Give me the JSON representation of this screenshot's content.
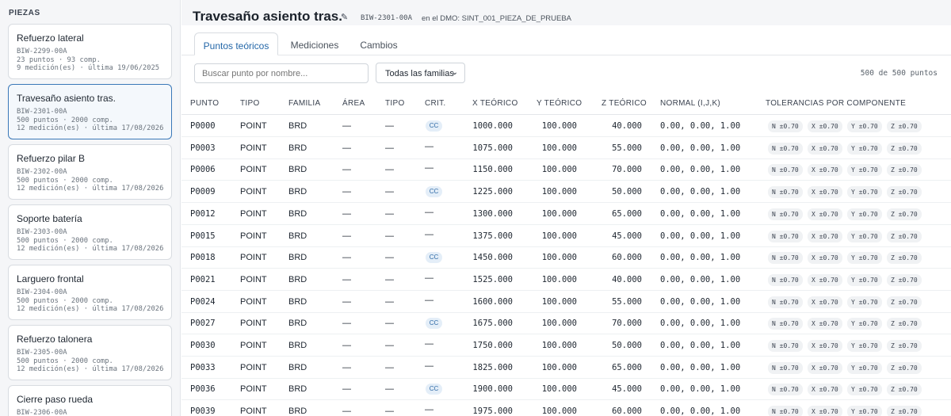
{
  "sidebar": {
    "title": "PIEZAS",
    "cards": [
      {
        "name": "Refuerzo lateral",
        "code": "BIW-2299-00A",
        "points": "23 puntos · 93 comp.",
        "measure": "9 medición(es) · última 19/06/2025"
      },
      {
        "name": "Travesaño asiento tras.",
        "code": "BIW-2301-00A",
        "points": "500 puntos · 2000 comp.",
        "measure": "12 medición(es) · última 17/08/2026"
      },
      {
        "name": "Refuerzo pilar B",
        "code": "BIW-2302-00A",
        "points": "500 puntos · 2000 comp.",
        "measure": "12 medición(es) · última 17/08/2026"
      },
      {
        "name": "Soporte batería",
        "code": "BIW-2303-00A",
        "points": "500 puntos · 2000 comp.",
        "measure": "12 medición(es) · última 17/08/2026"
      },
      {
        "name": "Larguero frontal",
        "code": "BIW-2304-00A",
        "points": "500 puntos · 2000 comp.",
        "measure": "12 medición(es) · última 17/08/2026"
      },
      {
        "name": "Refuerzo talonera",
        "code": "BIW-2305-00A",
        "points": "500 puntos · 2000 comp.",
        "measure": "12 medición(es) · última 17/08/2026"
      },
      {
        "name": "Cierre paso rueda",
        "code": "BIW-2306-00A",
        "points": "",
        "measure": ""
      }
    ]
  },
  "header": {
    "title": "Travesaño asiento tras.",
    "edit_icon": "pencil-icon",
    "code": "BIW-2301-00A",
    "dmo": "en el DMO: SINT_001_PIEZA_DE_PRUEBA"
  },
  "tabs": [
    "Puntos teóricos",
    "Mediciones",
    "Cambios"
  ],
  "filters": {
    "search_placeholder": "Buscar punto por nombre...",
    "family_select": "Todas las familias",
    "count": "500 de 500 puntos"
  },
  "table": {
    "columns": [
      "PUNTO",
      "TIPO",
      "FAMILIA",
      "ÁREA",
      "TIPO",
      "CRIT.",
      "X TEÓRICO",
      "Y TEÓRICO",
      "Z TEÓRICO",
      "NORMAL (I,J,K)",
      "TOLERANCIAS POR COMPONENTE"
    ],
    "rows": [
      {
        "punto": "P0000",
        "tipo": "POINT",
        "familia": "BRD",
        "area": "—",
        "tipo2": "—",
        "crit": "CC",
        "x": "1000.000",
        "y": "100.000",
        "z": "40.000",
        "normal": "0.00, 0.00, 1.00",
        "tol": [
          "N ±0.70",
          "X ±0.70",
          "Y ±0.70",
          "Z ±0.70"
        ]
      },
      {
        "punto": "P0003",
        "tipo": "POINT",
        "familia": "BRD",
        "area": "—",
        "tipo2": "—",
        "crit": "—",
        "x": "1075.000",
        "y": "100.000",
        "z": "55.000",
        "normal": "0.00, 0.00, 1.00",
        "tol": [
          "N ±0.70",
          "X ±0.70",
          "Y ±0.70",
          "Z ±0.70"
        ]
      },
      {
        "punto": "P0006",
        "tipo": "POINT",
        "familia": "BRD",
        "area": "—",
        "tipo2": "—",
        "crit": "—",
        "x": "1150.000",
        "y": "100.000",
        "z": "70.000",
        "normal": "0.00, 0.00, 1.00",
        "tol": [
          "N ±0.70",
          "X ±0.70",
          "Y ±0.70",
          "Z ±0.70"
        ]
      },
      {
        "punto": "P0009",
        "tipo": "POINT",
        "familia": "BRD",
        "area": "—",
        "tipo2": "—",
        "crit": "CC",
        "x": "1225.000",
        "y": "100.000",
        "z": "50.000",
        "normal": "0.00, 0.00, 1.00",
        "tol": [
          "N ±0.70",
          "X ±0.70",
          "Y ±0.70",
          "Z ±0.70"
        ]
      },
      {
        "punto": "P0012",
        "tipo": "POINT",
        "familia": "BRD",
        "area": "—",
        "tipo2": "—",
        "crit": "—",
        "x": "1300.000",
        "y": "100.000",
        "z": "65.000",
        "normal": "0.00, 0.00, 1.00",
        "tol": [
          "N ±0.70",
          "X ±0.70",
          "Y ±0.70",
          "Z ±0.70"
        ]
      },
      {
        "punto": "P0015",
        "tipo": "POINT",
        "familia": "BRD",
        "area": "—",
        "tipo2": "—",
        "crit": "—",
        "x": "1375.000",
        "y": "100.000",
        "z": "45.000",
        "normal": "0.00, 0.00, 1.00",
        "tol": [
          "N ±0.70",
          "X ±0.70",
          "Y ±0.70",
          "Z ±0.70"
        ]
      },
      {
        "punto": "P0018",
        "tipo": "POINT",
        "familia": "BRD",
        "area": "—",
        "tipo2": "—",
        "crit": "CC",
        "x": "1450.000",
        "y": "100.000",
        "z": "60.000",
        "normal": "0.00, 0.00, 1.00",
        "tol": [
          "N ±0.70",
          "X ±0.70",
          "Y ±0.70",
          "Z ±0.70"
        ]
      },
      {
        "punto": "P0021",
        "tipo": "POINT",
        "familia": "BRD",
        "area": "—",
        "tipo2": "—",
        "crit": "—",
        "x": "1525.000",
        "y": "100.000",
        "z": "40.000",
        "normal": "0.00, 0.00, 1.00",
        "tol": [
          "N ±0.70",
          "X ±0.70",
          "Y ±0.70",
          "Z ±0.70"
        ]
      },
      {
        "punto": "P0024",
        "tipo": "POINT",
        "familia": "BRD",
        "area": "—",
        "tipo2": "—",
        "crit": "—",
        "x": "1600.000",
        "y": "100.000",
        "z": "55.000",
        "normal": "0.00, 0.00, 1.00",
        "tol": [
          "N ±0.70",
          "X ±0.70",
          "Y ±0.70",
          "Z ±0.70"
        ]
      },
      {
        "punto": "P0027",
        "tipo": "POINT",
        "familia": "BRD",
        "area": "—",
        "tipo2": "—",
        "crit": "CC",
        "x": "1675.000",
        "y": "100.000",
        "z": "70.000",
        "normal": "0.00, 0.00, 1.00",
        "tol": [
          "N ±0.70",
          "X ±0.70",
          "Y ±0.70",
          "Z ±0.70"
        ]
      },
      {
        "punto": "P0030",
        "tipo": "POINT",
        "familia": "BRD",
        "area": "—",
        "tipo2": "—",
        "crit": "—",
        "x": "1750.000",
        "y": "100.000",
        "z": "50.000",
        "normal": "0.00, 0.00, 1.00",
        "tol": [
          "N ±0.70",
          "X ±0.70",
          "Y ±0.70",
          "Z ±0.70"
        ]
      },
      {
        "punto": "P0033",
        "tipo": "POINT",
        "familia": "BRD",
        "area": "—",
        "tipo2": "—",
        "crit": "—",
        "x": "1825.000",
        "y": "100.000",
        "z": "65.000",
        "normal": "0.00, 0.00, 1.00",
        "tol": [
          "N ±0.70",
          "X ±0.70",
          "Y ±0.70",
          "Z ±0.70"
        ]
      },
      {
        "punto": "P0036",
        "tipo": "POINT",
        "familia": "BRD",
        "area": "—",
        "tipo2": "—",
        "crit": "CC",
        "x": "1900.000",
        "y": "100.000",
        "z": "45.000",
        "normal": "0.00, 0.00, 1.00",
        "tol": [
          "N ±0.70",
          "X ±0.70",
          "Y ±0.70",
          "Z ±0.70"
        ]
      },
      {
        "punto": "P0039",
        "tipo": "POINT",
        "familia": "BRD",
        "area": "—",
        "tipo2": "—",
        "crit": "—",
        "x": "1975.000",
        "y": "100.000",
        "z": "60.000",
        "normal": "0.00, 0.00, 1.00",
        "tol": [
          "N ±0.70",
          "X ±0.70",
          "Y ±0.70",
          "Z ±0.70"
        ]
      }
    ]
  }
}
